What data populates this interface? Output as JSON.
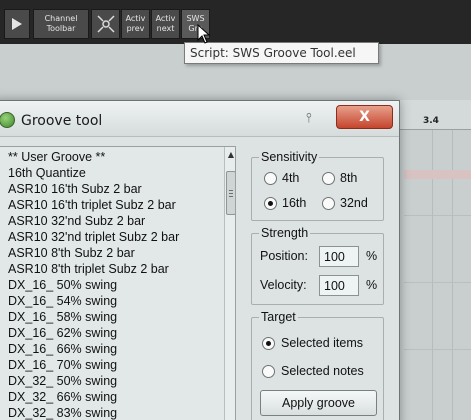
{
  "toolbar": {
    "play_icon": "play-icon",
    "channel_label": "Channel\nToolbar",
    "grid_icon": "crosshair-grid-icon",
    "prev_label": "Activ\nprev",
    "next_label": "Activ\nnext",
    "sws_label": "SWS\nGro"
  },
  "tooltip": {
    "text": "Script: SWS Groove Tool.eel"
  },
  "arrange": {
    "ruler_label": "3.4"
  },
  "window": {
    "title": "Groove tool",
    "close_label": "X",
    "list": {
      "items": [
        "** User Groove **",
        "16th Quantize",
        "ASR10 16'th Subz 2 bar",
        "ASR10 16'th triplet Subz 2 bar",
        "ASR10 32'nd Subz 2 bar",
        "ASR10 32'nd triplet Subz 2 bar",
        "ASR10 8'th Subz 2 bar",
        "ASR10 8'th triplet Subz 2 bar",
        "DX_16_ 50% swing",
        "DX_16_ 54% swing",
        "DX_16_ 58% swing",
        "DX_16_ 62% swing",
        "DX_16_ 66% swing",
        "DX_16_ 70% swing",
        "DX_32_ 50% swing",
        "DX_32_ 66% swing",
        "DX_32_ 83% swing"
      ]
    },
    "sensitivity": {
      "label": "Sensitivity",
      "options": [
        "4th",
        "8th",
        "16th",
        "32nd"
      ],
      "selected": "16th"
    },
    "strength": {
      "label": "Strength",
      "position_label": "Position:",
      "position_value": "100",
      "velocity_label": "Velocity:",
      "velocity_value": "100",
      "unit": "%"
    },
    "target": {
      "label": "Target",
      "options": [
        "Selected items",
        "Selected notes"
      ],
      "selected": "Selected items",
      "apply_label": "Apply groove"
    }
  }
}
